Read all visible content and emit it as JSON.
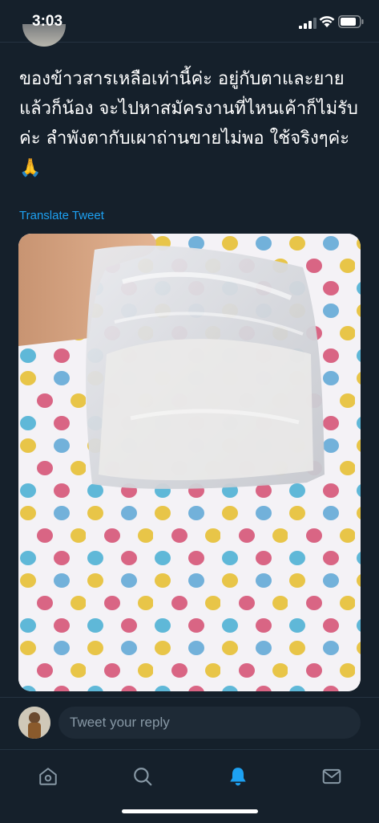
{
  "status_bar": {
    "time": "3:03",
    "icons": [
      "signal-icon",
      "wifi-icon",
      "battery-icon"
    ]
  },
  "tweet": {
    "text": "ของข้าวสารเหลือเท่านี้ค่ะ อยู่กับตาและยายแล้วก็น้อง จะไปหาสมัครงานที่ไหนเค้าก็ไม่รับค่ะ ลำพังตากับเผาถ่านขายไม่พอ ใช้จริงๆค่ะ 🙏",
    "translate_label": "Translate Tweet",
    "photo_subject": "plastic bag of rice on polka-dot cloth"
  },
  "reply": {
    "placeholder": "Tweet your reply"
  },
  "tab_bar": {
    "tabs": [
      {
        "icon": "home-icon",
        "active": false
      },
      {
        "icon": "search-icon",
        "active": false
      },
      {
        "icon": "notifications-icon",
        "active": true
      },
      {
        "icon": "messages-icon",
        "active": false
      }
    ]
  },
  "colors": {
    "background": "#15202b",
    "accent": "#1da1f2",
    "muted": "#8899a6",
    "divider": "#253341"
  }
}
